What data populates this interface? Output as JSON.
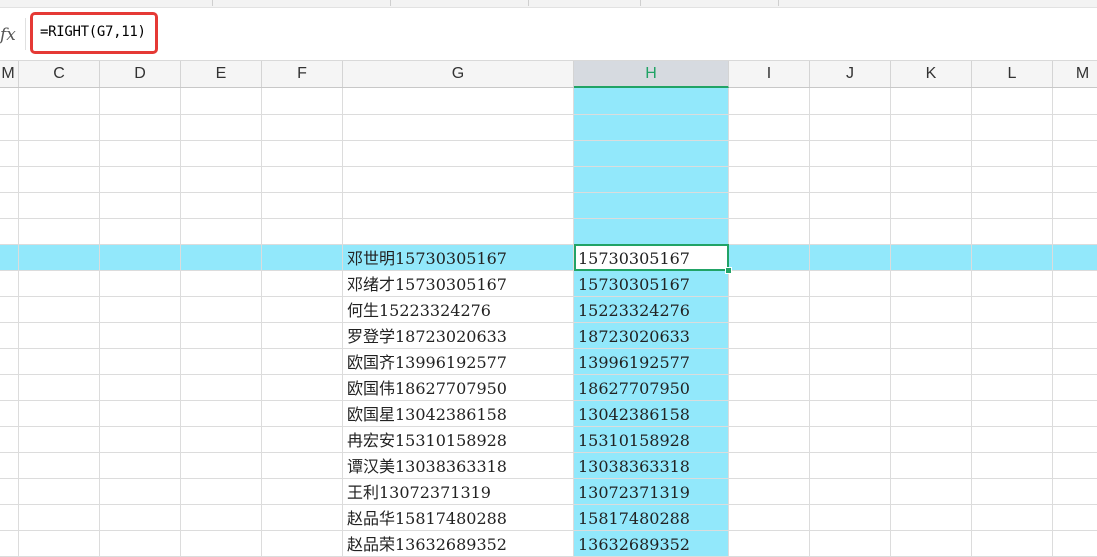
{
  "formula_bar": {
    "fx_label": "fx",
    "formula": "=RIGHT(G7,11)"
  },
  "columns": [
    "M",
    "C",
    "D",
    "E",
    "F",
    "G",
    "H",
    "I",
    "J",
    "K",
    "L",
    "M"
  ],
  "selected_column": "H",
  "active_cell_value": "15730305167",
  "rows": [
    {
      "g": "",
      "h": ""
    },
    {
      "g": "",
      "h": ""
    },
    {
      "g": "",
      "h": ""
    },
    {
      "g": "",
      "h": ""
    },
    {
      "g": "",
      "h": ""
    },
    {
      "g": "",
      "h": ""
    },
    {
      "g": "邓世明15730305167",
      "h": "15730305167"
    },
    {
      "g": "邓绪才15730305167",
      "h": "15730305167"
    },
    {
      "g": "何生15223324276",
      "h": "15223324276"
    },
    {
      "g": "罗登学18723020633",
      "h": "18723020633"
    },
    {
      "g": "欧国齐13996192577",
      "h": "13996192577"
    },
    {
      "g": "欧国伟18627707950",
      "h": "18627707950"
    },
    {
      "g": "欧国星13042386158",
      "h": "13042386158"
    },
    {
      "g": "冉宏安15310158928",
      "h": "15310158928"
    },
    {
      "g": "谭汉美13038363318",
      "h": "13038363318"
    },
    {
      "g": "王利13072371319",
      "h": "13072371319"
    },
    {
      "g": "赵品华15817480288",
      "h": "15817480288"
    },
    {
      "g": "赵品荣13632689352",
      "h": "13632689352"
    }
  ],
  "colors": {
    "highlight": "#92e8fb",
    "selection_green": "#21a366",
    "callout_red": "#e53935"
  }
}
